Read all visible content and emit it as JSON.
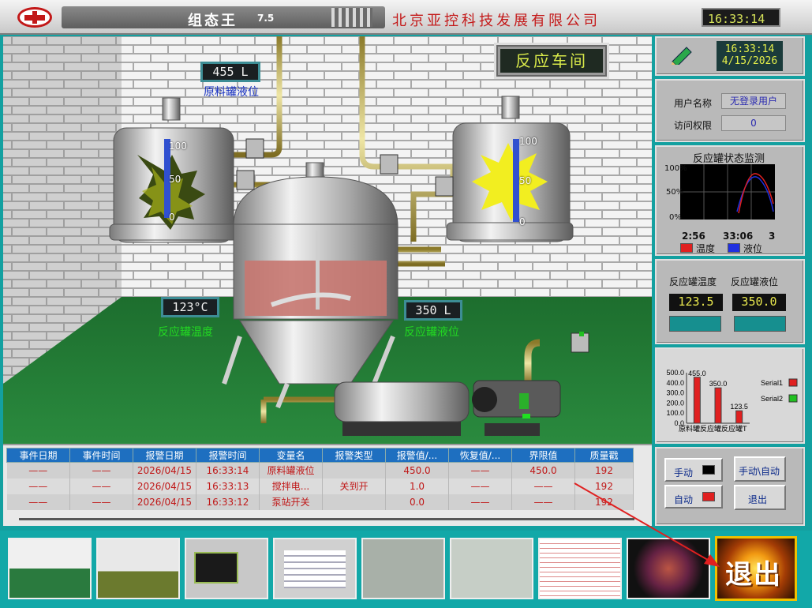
{
  "titlebar": {
    "app_name": "组态王",
    "version": "7.5",
    "company": "北京亚控科技发展有限公司",
    "clock": "16:33:14"
  },
  "scene": {
    "workshop_title": "反应车间",
    "raw_tank_level": {
      "value": "455 L",
      "label": "原料罐液位"
    },
    "reactor_temp": {
      "value": "123°C",
      "label": "反应罐温度"
    },
    "reactor_level": {
      "value": "350  L",
      "label": "反应罐液位"
    },
    "left_gauge_ticks": [
      "100",
      "50",
      "0"
    ],
    "right_gauge_ticks": [
      "100",
      "50",
      "0"
    ]
  },
  "right_panel": {
    "datetime": {
      "time": "16:33:14",
      "date": "4/15/2026"
    },
    "user": {
      "name_label": "用户名称",
      "name_value": "无登录用户",
      "perm_label": "访问权限",
      "perm_value": "0"
    },
    "trend": {
      "title": "反应罐状态监测",
      "y_ticks": [
        "100%",
        "50%",
        "0%"
      ],
      "x_ticks": [
        "2:56",
        "33:06",
        "3"
      ],
      "legend": [
        {
          "label": "温度",
          "color": "#e02020"
        },
        {
          "label": "液位",
          "color": "#2030e0"
        }
      ]
    },
    "readouts": {
      "temp_label": "反应罐温度",
      "temp_value": "123.5",
      "level_label": "反应罐液位",
      "level_value": "350.0"
    },
    "buttons": {
      "manual": "手动",
      "manual_auto": "手动\\自动",
      "auto": "自动",
      "exit": "退出"
    }
  },
  "chart_data": {
    "type": "bar",
    "categories": [
      "原料罐",
      "反应罐",
      "反应罐T"
    ],
    "series": [
      {
        "name": "Serial1",
        "values": [
          455.0,
          350.0,
          123.5
        ]
      }
    ],
    "value_labels": [
      "455.0",
      "350.0",
      "123.5"
    ],
    "y_ticks": [
      "500.0",
      "400.0",
      "300.0",
      "200.0",
      "100.0",
      "0.0"
    ],
    "ylim": [
      0,
      500
    ],
    "legend": [
      {
        "name": "Serial1",
        "color": "#e02020"
      },
      {
        "name": "Serial2",
        "color": "#20c020"
      }
    ],
    "legend_position": "right",
    "category_labels": "原料罐反应罐反应罐T"
  },
  "alarm_table": {
    "columns": [
      "事件日期",
      "事件时间",
      "报警日期",
      "报警时间",
      "变量名",
      "报警类型",
      "报警值/...",
      "恢复值/...",
      "界限值",
      "质量戳"
    ],
    "rows": [
      [
        "——",
        "——",
        "2026/04/15",
        "16:33:14",
        "原料罐液位",
        "",
        "450.0",
        "——",
        "450.0",
        "192"
      ],
      [
        "——",
        "——",
        "2026/04/15",
        "16:33:13",
        "搅拌电...",
        "关到开",
        "1.0",
        "——",
        "——",
        "192"
      ],
      [
        "——",
        "——",
        "2026/04/15",
        "16:33:12",
        "泵站开关",
        "",
        "0.0",
        "——",
        "——",
        "192"
      ]
    ]
  },
  "thumbnails": {
    "exit_label": "退出",
    "arrow_color": "#e02020"
  }
}
